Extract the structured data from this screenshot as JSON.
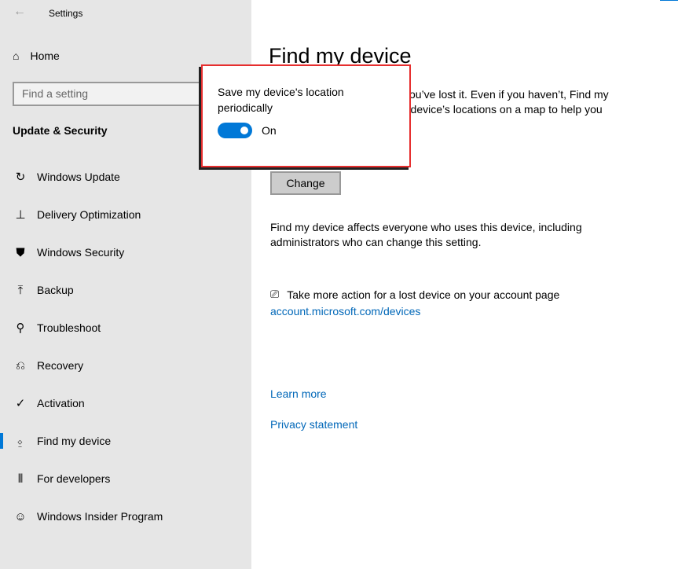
{
  "window": {
    "title": "Settings",
    "back_icon": "back-arrow-icon"
  },
  "sidebar": {
    "home": "Home",
    "search_placeholder": "Find a setting",
    "section": "Update & Security",
    "items": [
      {
        "label": "Windows Update",
        "icon": "↻"
      },
      {
        "label": "Delivery Optimization",
        "icon": "⊥"
      },
      {
        "label": "Windows Security",
        "icon": "⛊"
      },
      {
        "label": "Backup",
        "icon": "⤒"
      },
      {
        "label": "Troubleshoot",
        "icon": "⚲"
      },
      {
        "label": "Recovery",
        "icon": "⎌"
      },
      {
        "label": "Activation",
        "icon": "✓"
      },
      {
        "label": "Find my device",
        "icon": "⍚",
        "active": true
      },
      {
        "label": "For developers",
        "icon": "⫴"
      },
      {
        "label": "Windows Insider Program",
        "icon": "☺"
      }
    ]
  },
  "main": {
    "title": "Find my device",
    "desc_line1": "you’ve lost it. Even if you haven’t, Find my",
    "desc_line2": "r device’s locations on a map to help you",
    "change": "Change",
    "affects": "Find my device affects everyone who uses this device, including administrators who can change this setting.",
    "action_text": "Take more action for a lost device on your account page",
    "account_link": "account.microsoft.com/devices",
    "learn_more": "Learn more",
    "privacy": "Privacy statement"
  },
  "popup": {
    "label": "Save my device's location periodically",
    "toggle_state": "On",
    "toggle_on": true
  },
  "colors": {
    "accent": "#0078d7",
    "link": "#0067b8",
    "highlight_border": "#e62e2e"
  }
}
